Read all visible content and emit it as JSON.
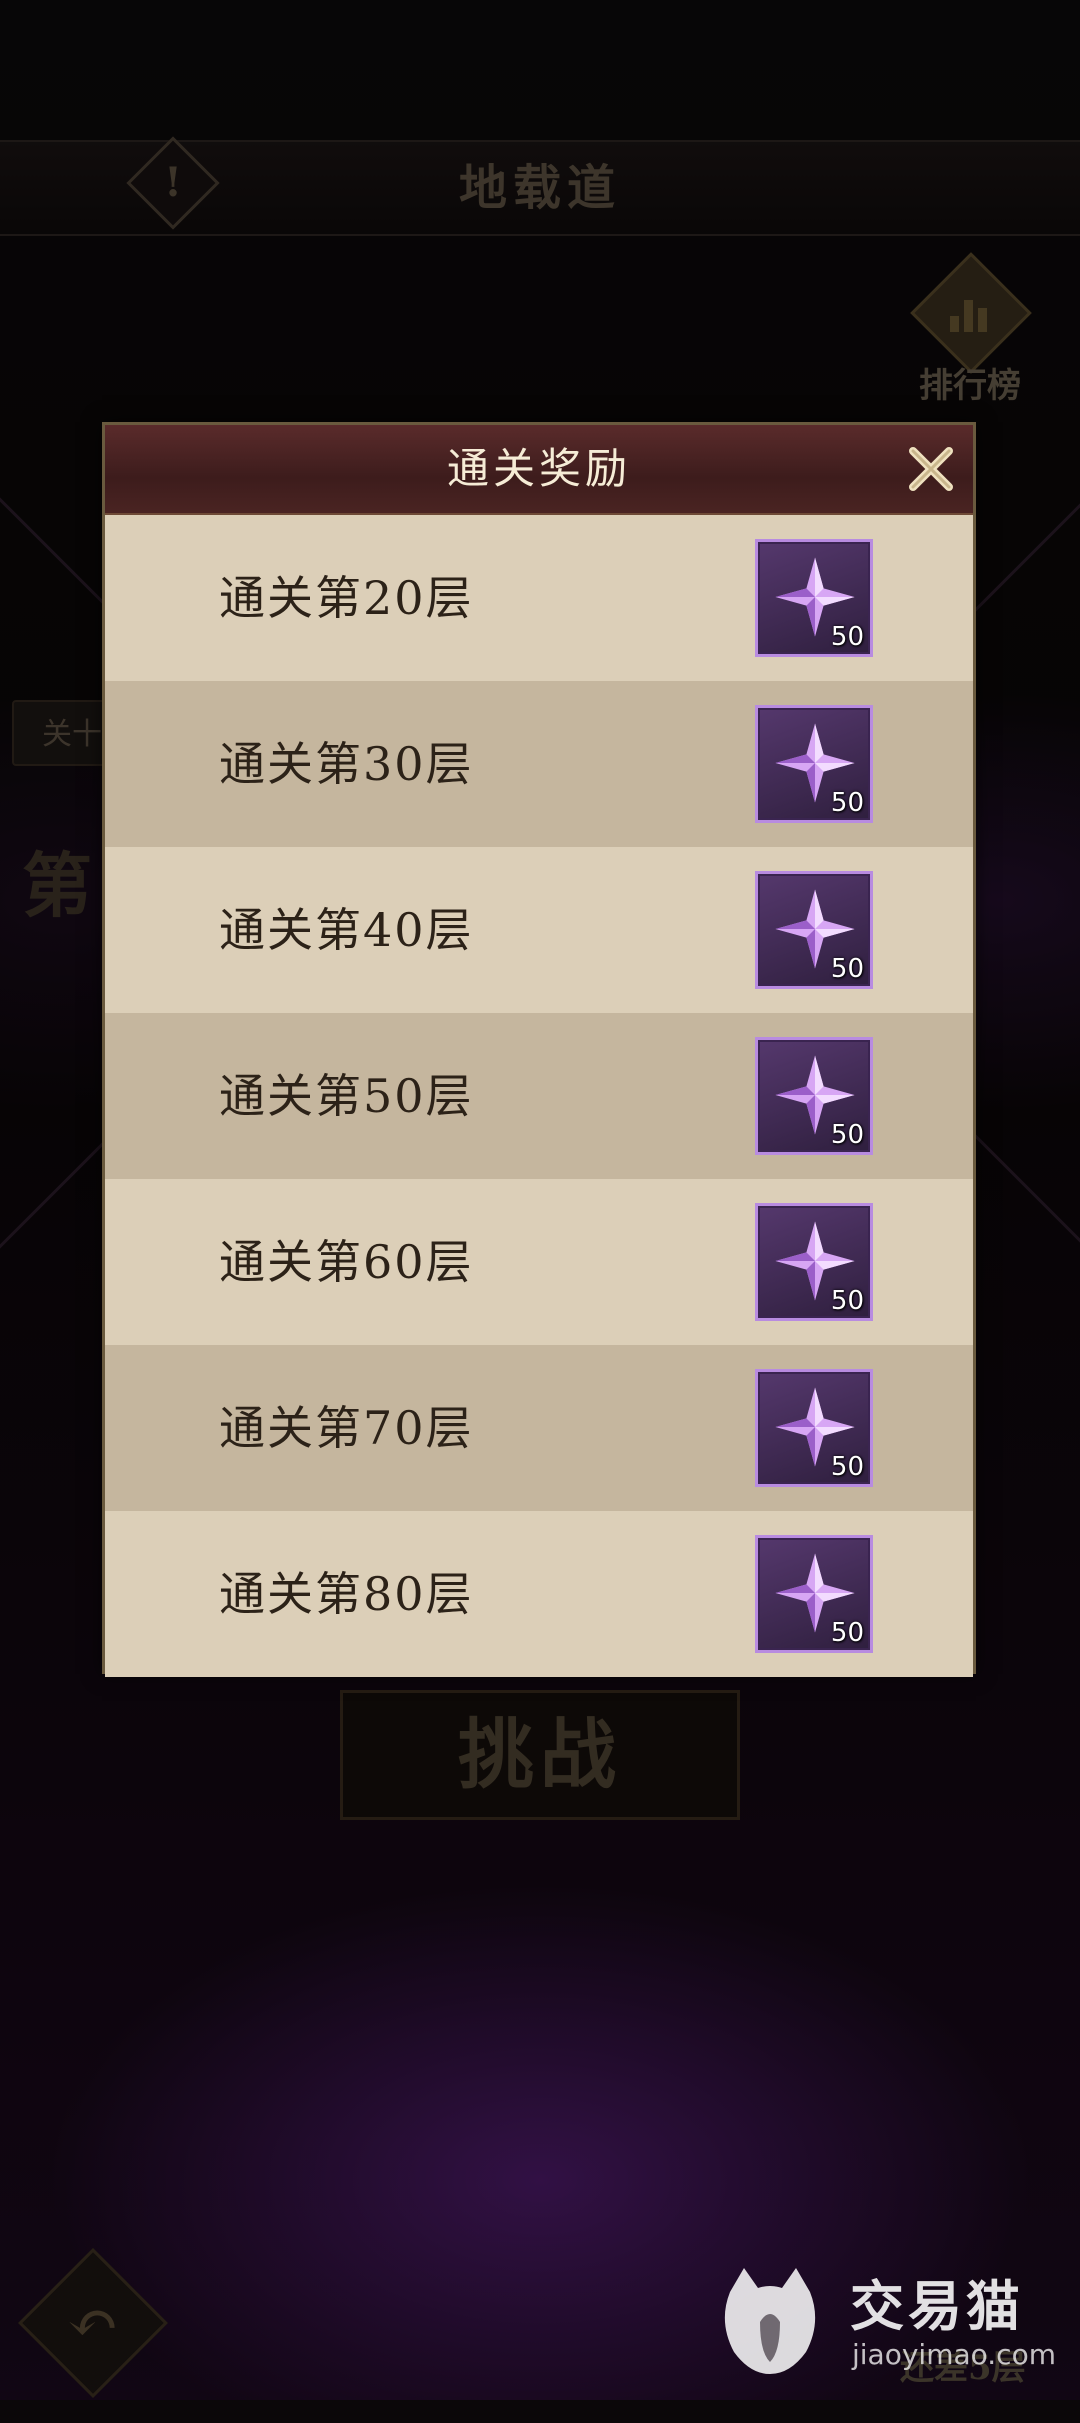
{
  "background": {
    "page_title": "地载道",
    "info_icon_glyph": "!",
    "ranking_label": "排行榜",
    "side_tag": "关十",
    "side_text": "第",
    "challenge_label": "挑战",
    "back_glyph": "↶",
    "bottom_right_text": "还差5层"
  },
  "watermark": {
    "name": "交易猫",
    "url": "jiaoyimao.com"
  },
  "modal": {
    "title": "通关奖励",
    "close_icon": "close-icon",
    "rows": [
      {
        "label": "通关第20层",
        "reward_icon": "purple-star-gem-icon",
        "count": "50"
      },
      {
        "label": "通关第30层",
        "reward_icon": "purple-star-gem-icon",
        "count": "50"
      },
      {
        "label": "通关第40层",
        "reward_icon": "purple-star-gem-icon",
        "count": "50"
      },
      {
        "label": "通关第50层",
        "reward_icon": "purple-star-gem-icon",
        "count": "50"
      },
      {
        "label": "通关第60层",
        "reward_icon": "purple-star-gem-icon",
        "count": "50"
      },
      {
        "label": "通关第70层",
        "reward_icon": "purple-star-gem-icon",
        "count": "50"
      },
      {
        "label": "通关第80层",
        "reward_icon": "purple-star-gem-icon",
        "count": "50"
      }
    ]
  },
  "colors": {
    "modal_bg_light": "#dccfb8",
    "modal_bg_dark": "#c5b69e",
    "header_red": "#4a2422",
    "reward_border": "#b88be0"
  }
}
